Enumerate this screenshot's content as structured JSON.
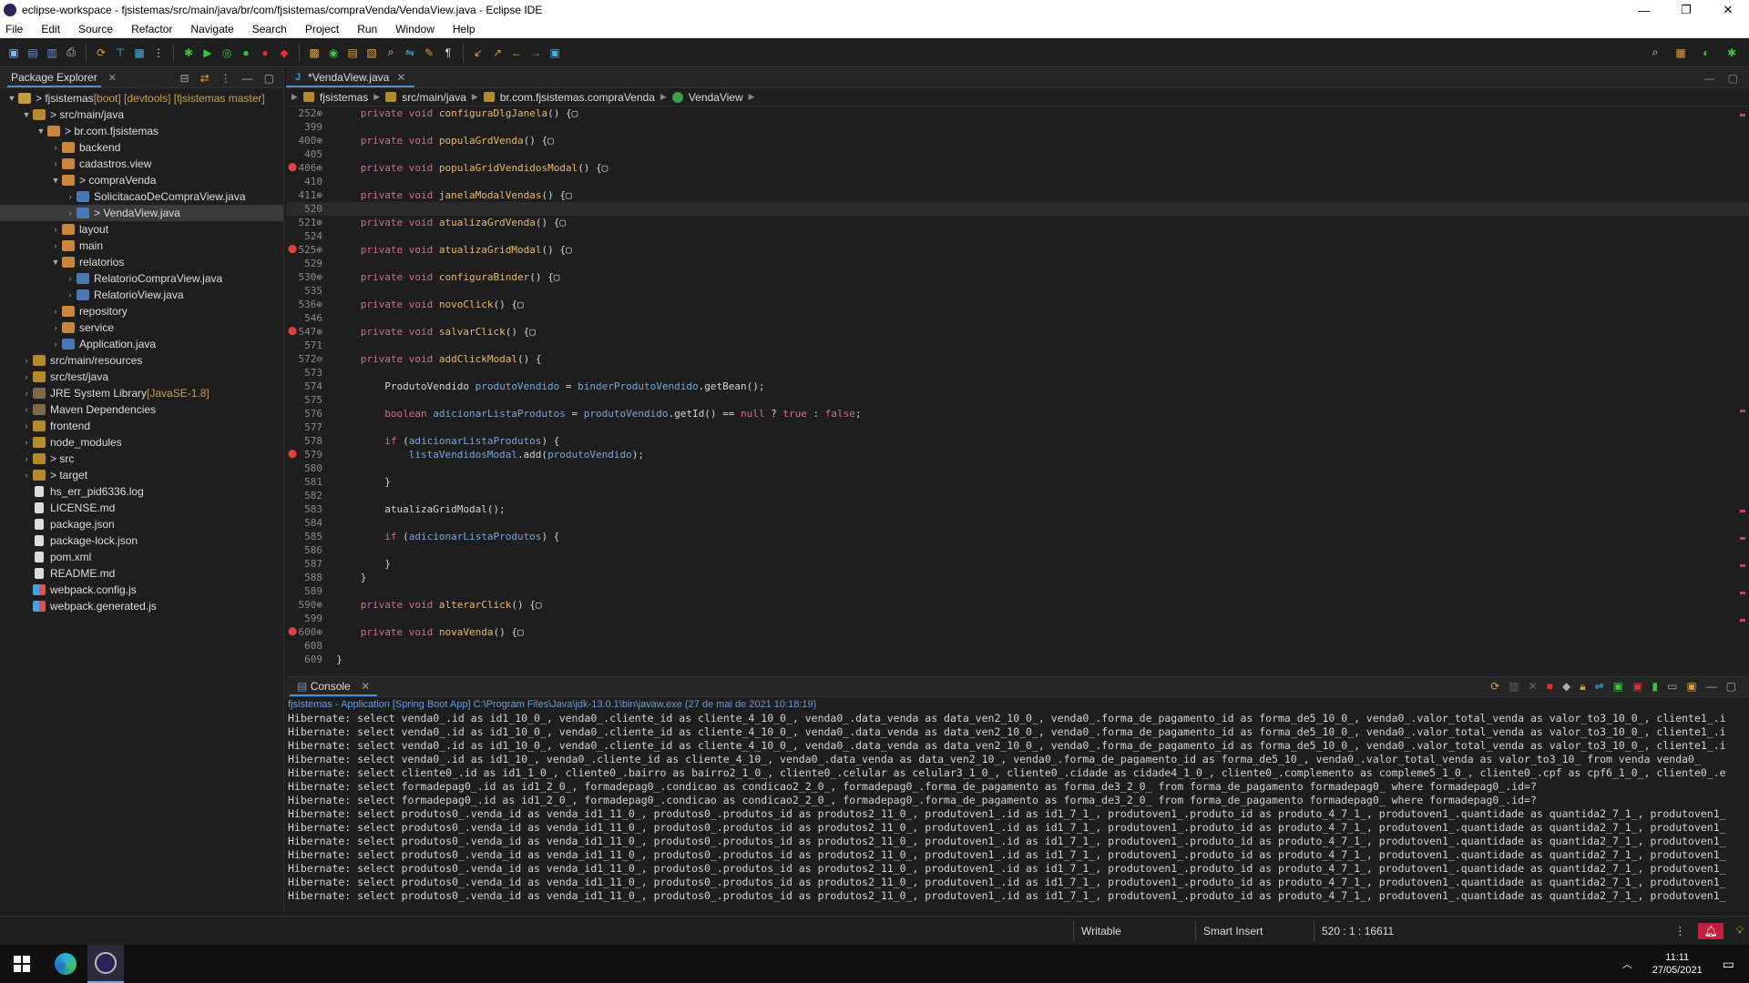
{
  "window": {
    "title": "eclipse-workspace - fjsistemas/src/main/java/br/com/fjsistemas/compraVenda/VendaView.java - Eclipse IDE",
    "controls": [
      "—",
      "❐",
      "✕"
    ]
  },
  "menu": [
    "File",
    "Edit",
    "Source",
    "Refactor",
    "Navigate",
    "Search",
    "Project",
    "Run",
    "Window",
    "Help"
  ],
  "explorer": {
    "tab_label": "Package Explorer",
    "tree": [
      {
        "indent": 0,
        "arrow": "▼",
        "icon": "proj",
        "label": "> fjsistemas",
        "deco": " [boot] [devtools] [fjsistemas master]"
      },
      {
        "indent": 1,
        "arrow": "▼",
        "icon": "folder",
        "label": "> src/main/java",
        "deco": ""
      },
      {
        "indent": 2,
        "arrow": "▼",
        "icon": "pkg",
        "label": "> br.com.fjsistemas",
        "deco": ""
      },
      {
        "indent": 3,
        "arrow": "›",
        "icon": "pkg",
        "label": "backend",
        "deco": ""
      },
      {
        "indent": 3,
        "arrow": "›",
        "icon": "pkg",
        "label": "cadastros.view",
        "deco": ""
      },
      {
        "indent": 3,
        "arrow": "▼",
        "icon": "pkg",
        "label": "> compraVenda",
        "deco": ""
      },
      {
        "indent": 4,
        "arrow": "›",
        "icon": "java",
        "label": "SolicitacaoDeCompraView.java",
        "deco": ""
      },
      {
        "indent": 4,
        "arrow": "›",
        "icon": "java",
        "label": "> VendaView.java",
        "deco": "",
        "selected": true
      },
      {
        "indent": 3,
        "arrow": "›",
        "icon": "pkg",
        "label": "layout",
        "deco": ""
      },
      {
        "indent": 3,
        "arrow": "›",
        "icon": "pkg",
        "label": "main",
        "deco": ""
      },
      {
        "indent": 3,
        "arrow": "▼",
        "icon": "pkg",
        "label": "relatorios",
        "deco": ""
      },
      {
        "indent": 4,
        "arrow": "›",
        "icon": "java",
        "label": "RelatorioCompraView.java",
        "deco": ""
      },
      {
        "indent": 4,
        "arrow": "›",
        "icon": "java",
        "label": "RelatorioView.java",
        "deco": ""
      },
      {
        "indent": 3,
        "arrow": "›",
        "icon": "pkg",
        "label": "repository",
        "deco": ""
      },
      {
        "indent": 3,
        "arrow": "›",
        "icon": "pkg",
        "label": "service",
        "deco": ""
      },
      {
        "indent": 3,
        "arrow": "›",
        "icon": "java",
        "label": "Application.java",
        "deco": ""
      },
      {
        "indent": 1,
        "arrow": "›",
        "icon": "folder",
        "label": "src/main/resources",
        "deco": ""
      },
      {
        "indent": 1,
        "arrow": "›",
        "icon": "folder",
        "label": "src/test/java",
        "deco": ""
      },
      {
        "indent": 1,
        "arrow": "›",
        "icon": "lib",
        "label": "JRE System Library",
        "deco": " [JavaSE-1.8]"
      },
      {
        "indent": 1,
        "arrow": "›",
        "icon": "lib",
        "label": "Maven Dependencies",
        "deco": ""
      },
      {
        "indent": 1,
        "arrow": "›",
        "icon": "folder",
        "label": "frontend",
        "deco": ""
      },
      {
        "indent": 1,
        "arrow": "›",
        "icon": "folder",
        "label": "node_modules",
        "deco": ""
      },
      {
        "indent": 1,
        "arrow": "›",
        "icon": "folder",
        "label": "> src",
        "deco": ""
      },
      {
        "indent": 1,
        "arrow": "›",
        "icon": "folder",
        "label": "> target",
        "deco": ""
      },
      {
        "indent": 1,
        "arrow": "",
        "icon": "file",
        "label": "hs_err_pid6336.log",
        "deco": ""
      },
      {
        "indent": 1,
        "arrow": "",
        "icon": "file",
        "label": "LICENSE.md",
        "deco": ""
      },
      {
        "indent": 1,
        "arrow": "",
        "icon": "file",
        "label": "package.json",
        "deco": ""
      },
      {
        "indent": 1,
        "arrow": "",
        "icon": "file",
        "label": "package-lock.json",
        "deco": ""
      },
      {
        "indent": 1,
        "arrow": "",
        "icon": "file",
        "label": "pom.xml",
        "deco": ""
      },
      {
        "indent": 1,
        "arrow": "",
        "icon": "file",
        "label": "README.md",
        "deco": ""
      },
      {
        "indent": 1,
        "arrow": "",
        "icon": "js",
        "label": "webpack.config.js",
        "deco": ""
      },
      {
        "indent": 1,
        "arrow": "",
        "icon": "js",
        "label": "webpack.generated.js",
        "deco": ""
      }
    ]
  },
  "editor": {
    "tab_label": "*VendaView.java",
    "breadcrumb": [
      "fjsistemas",
      "src/main/java",
      "br.com.fjsistemas.compraVenda",
      "VendaView"
    ],
    "lines": [
      {
        "n": "252⊕",
        "html": "    <span class='kw'>private void</span> <span class='fn'>configuraDlgJanela</span>() {▢"
      },
      {
        "n": "399",
        "html": ""
      },
      {
        "n": "400⊕",
        "html": "    <span class='kw'>private void</span> <span class='fn'>populaGrdVenda</span>() {▢"
      },
      {
        "n": "405",
        "html": ""
      },
      {
        "n": "406⊕",
        "bp": true,
        "html": "    <span class='kw'>private void</span> <span class='fn'>populaGridVendidosModal</span>() {▢"
      },
      {
        "n": "410",
        "html": ""
      },
      {
        "n": "411⊕",
        "html": "    <span class='kw'>private void</span> <span class='fn'>janelaModalVendas</span>() {▢"
      },
      {
        "n": "520",
        "hl": true,
        "html": ""
      },
      {
        "n": "521⊕",
        "html": "    <span class='kw'>private void</span> <span class='fn'>atualizaGrdVenda</span>() {▢"
      },
      {
        "n": "524",
        "html": ""
      },
      {
        "n": "525⊕",
        "bp": true,
        "html": "    <span class='kw'>private void</span> <span class='fn'>atualizaGridModal</span>() {▢"
      },
      {
        "n": "529",
        "html": ""
      },
      {
        "n": "530⊕",
        "html": "    <span class='kw'>private void</span> <span class='fn'>configuraBinder</span>() {▢"
      },
      {
        "n": "535",
        "html": ""
      },
      {
        "n": "536⊕",
        "html": "    <span class='kw'>private void</span> <span class='fn'>novoClick</span>() {▢"
      },
      {
        "n": "546",
        "html": ""
      },
      {
        "n": "547⊕",
        "bp": true,
        "html": "    <span class='kw'>private void</span> <span class='fn'>salvarClick</span>() {▢"
      },
      {
        "n": "571",
        "html": ""
      },
      {
        "n": "572⊖",
        "html": "    <span class='kw'>private void</span> <span class='fn'>addClickModal</span>() {"
      },
      {
        "n": "573",
        "html": ""
      },
      {
        "n": "574",
        "html": "        ProdutoVendido <span class='var'>produtoVendido</span> = <span class='var'>binderProdutoVendido</span>.getBean();"
      },
      {
        "n": "575",
        "html": ""
      },
      {
        "n": "576",
        "html": "        <span class='kw'>boolean</span> <span class='var'>adicionarListaProdutos</span> = <span class='var'>produtoVendido</span>.getId() == <span class='lit'>null</span> ? <span class='lit'>true</span> : <span class='lit'>false</span>;"
      },
      {
        "n": "577",
        "html": ""
      },
      {
        "n": "578",
        "html": "        <span class='kw'>if</span> (<span class='var'>adicionarListaProdutos</span>) {"
      },
      {
        "n": "579",
        "bp": true,
        "html": "            <span class='var'>listaVendidosModal</span>.add(<span class='var'>produtoVendido</span>);"
      },
      {
        "n": "580",
        "html": ""
      },
      {
        "n": "581",
        "html": "        }"
      },
      {
        "n": "582",
        "html": ""
      },
      {
        "n": "583",
        "html": "        atualizaGridModal();"
      },
      {
        "n": "584",
        "html": ""
      },
      {
        "n": "585",
        "html": "        <span class='kw'>if</span> (<span class='var'>adicionarListaProdutos</span>) {"
      },
      {
        "n": "586",
        "html": ""
      },
      {
        "n": "587",
        "html": "        }"
      },
      {
        "n": "588",
        "html": "    }"
      },
      {
        "n": "589",
        "html": ""
      },
      {
        "n": "590⊕",
        "html": "    <span class='kw'>private void</span> <span class='fn'>alterarClick</span>() {▢"
      },
      {
        "n": "599",
        "html": ""
      },
      {
        "n": "600⊕",
        "bp": true,
        "html": "    <span class='kw'>private void</span> <span class='fn'>novaVenda</span>() {▢"
      },
      {
        "n": "608",
        "html": ""
      },
      {
        "n": "609",
        "html": "}"
      }
    ]
  },
  "console": {
    "tab_label": "Console",
    "description": "fjsistemas - Application [Spring Boot App] C:\\Program Files\\Java\\jdk-13.0.1\\bin\\javaw.exe  (27 de mai de 2021 10:18:19)",
    "lines": [
      "Hibernate: select venda0_.id as id1_10_0_, venda0_.cliente_id as cliente_4_10_0_, venda0_.data_venda as data_ven2_10_0_, venda0_.forma_de_pagamento_id as forma_de5_10_0_, venda0_.valor_total_venda as valor_to3_10_0_, cliente1_.i",
      "Hibernate: select venda0_.id as id1_10_0_, venda0_.cliente_id as cliente_4_10_0_, venda0_.data_venda as data_ven2_10_0_, venda0_.forma_de_pagamento_id as forma_de5_10_0_, venda0_.valor_total_venda as valor_to3_10_0_, cliente1_.i",
      "Hibernate: select venda0_.id as id1_10_0_, venda0_.cliente_id as cliente_4_10_0_, venda0_.data_venda as data_ven2_10_0_, venda0_.forma_de_pagamento_id as forma_de5_10_0_, venda0_.valor_total_venda as valor_to3_10_0_, cliente1_.i",
      "Hibernate: select venda0_.id as id1_10_, venda0_.cliente_id as cliente_4_10_, venda0_.data_venda as data_ven2_10_, venda0_.forma_de_pagamento_id as forma_de5_10_, venda0_.valor_total_venda as valor_to3_10_ from venda venda0_",
      "Hibernate: select cliente0_.id as id1_1_0_, cliente0_.bairro as bairro2_1_0_, cliente0_.celular as celular3_1_0_, cliente0_.cidade as cidade4_1_0_, cliente0_.complemento as compleme5_1_0_, cliente0_.cpf as cpf6_1_0_, cliente0_.e",
      "Hibernate: select formadepag0_.id as id1_2_0_, formadepag0_.condicao as condicao2_2_0_, formadepag0_.forma_de_pagamento as forma_de3_2_0_ from forma_de_pagamento formadepag0_ where formadepag0_.id=?",
      "Hibernate: select formadepag0_.id as id1_2_0_, formadepag0_.condicao as condicao2_2_0_, formadepag0_.forma_de_pagamento as forma_de3_2_0_ from forma_de_pagamento formadepag0_ where formadepag0_.id=?",
      "Hibernate: select produtos0_.venda_id as venda_id1_11_0_, produtos0_.produtos_id as produtos2_11_0_, produtoven1_.id as id1_7_1_, produtoven1_.produto_id as produto_4_7_1_, produtoven1_.quantidade as quantida2_7_1_, produtoven1_",
      "Hibernate: select produtos0_.venda_id as venda_id1_11_0_, produtos0_.produtos_id as produtos2_11_0_, produtoven1_.id as id1_7_1_, produtoven1_.produto_id as produto_4_7_1_, produtoven1_.quantidade as quantida2_7_1_, produtoven1_",
      "Hibernate: select produtos0_.venda_id as venda_id1_11_0_, produtos0_.produtos_id as produtos2_11_0_, produtoven1_.id as id1_7_1_, produtoven1_.produto_id as produto_4_7_1_, produtoven1_.quantidade as quantida2_7_1_, produtoven1_",
      "Hibernate: select produtos0_.venda_id as venda_id1_11_0_, produtos0_.produtos_id as produtos2_11_0_, produtoven1_.id as id1_7_1_, produtoven1_.produto_id as produto_4_7_1_, produtoven1_.quantidade as quantida2_7_1_, produtoven1_",
      "Hibernate: select produtos0_.venda_id as venda_id1_11_0_, produtos0_.produtos_id as produtos2_11_0_, produtoven1_.id as id1_7_1_, produtoven1_.produto_id as produto_4_7_1_, produtoven1_.quantidade as quantida2_7_1_, produtoven1_",
      "Hibernate: select produtos0_.venda_id as venda_id1_11_0_, produtos0_.produtos_id as produtos2_11_0_, produtoven1_.id as id1_7_1_, produtoven1_.produto_id as produto_4_7_1_, produtoven1_.quantidade as quantida2_7_1_, produtoven1_",
      "Hibernate: select produtos0_.venda_id as venda_id1_11_0_, produtos0_.produtos_id as produtos2_11_0_, produtoven1_.id as id1_7_1_, produtoven1_.produto_id as produto_4_7_1_, produtoven1_.quantidade as quantida2_7_1_, produtoven1_"
    ]
  },
  "status": {
    "writable": "Writable",
    "insert_mode": "Smart Insert",
    "position": "520 : 1 : 16611"
  },
  "taskbar": {
    "time": "11:11",
    "date": "27/05/2021"
  }
}
